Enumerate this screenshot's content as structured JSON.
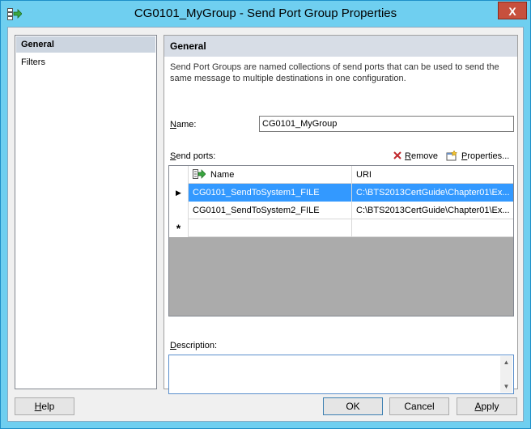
{
  "window": {
    "title": "CG0101_MyGroup - Send Port Group Properties",
    "close_glyph": "X"
  },
  "nav": {
    "items": [
      {
        "label": "General",
        "selected": true
      },
      {
        "label": "Filters",
        "selected": false
      }
    ]
  },
  "general": {
    "header": "General",
    "description_line1": "Send Port Groups are named collections of send ports that can be used to send the",
    "description_line2": "same message to multiple destinations in one configuration.",
    "name_label_accel": "N",
    "name_label_rest": "ame:",
    "name_value": "CG0101_MyGroup",
    "send_ports_label_accel": "S",
    "send_ports_label_rest": "end ports:",
    "remove_label_accel": "R",
    "remove_label_rest": "emove",
    "properties_label_accel": "P",
    "properties_label_rest": "roperties...",
    "grid": {
      "columns": [
        "Name",
        "URI"
      ],
      "rows": [
        {
          "name": "CG0101_SendToSystem1_FILE",
          "uri": "C:\\BTS2013CertGuide\\Chapter01\\Ex...",
          "selected": true
        },
        {
          "name": "CG0101_SendToSystem2_FILE",
          "uri": "C:\\BTS2013CertGuide\\Chapter01\\Ex...",
          "selected": false
        }
      ],
      "new_row_marker": "*",
      "current_row_marker": "▶"
    },
    "description_label_accel": "D",
    "description_label_rest": "escription:",
    "description_value": ""
  },
  "buttons": {
    "help_accel": "H",
    "help_rest": "elp",
    "ok": "OK",
    "cancel": "Cancel",
    "apply_accel": "A",
    "apply_rest": "pply"
  },
  "colors": {
    "titlebar": "#6fcff0",
    "selection": "#3399ff",
    "close": "#c7503d"
  }
}
